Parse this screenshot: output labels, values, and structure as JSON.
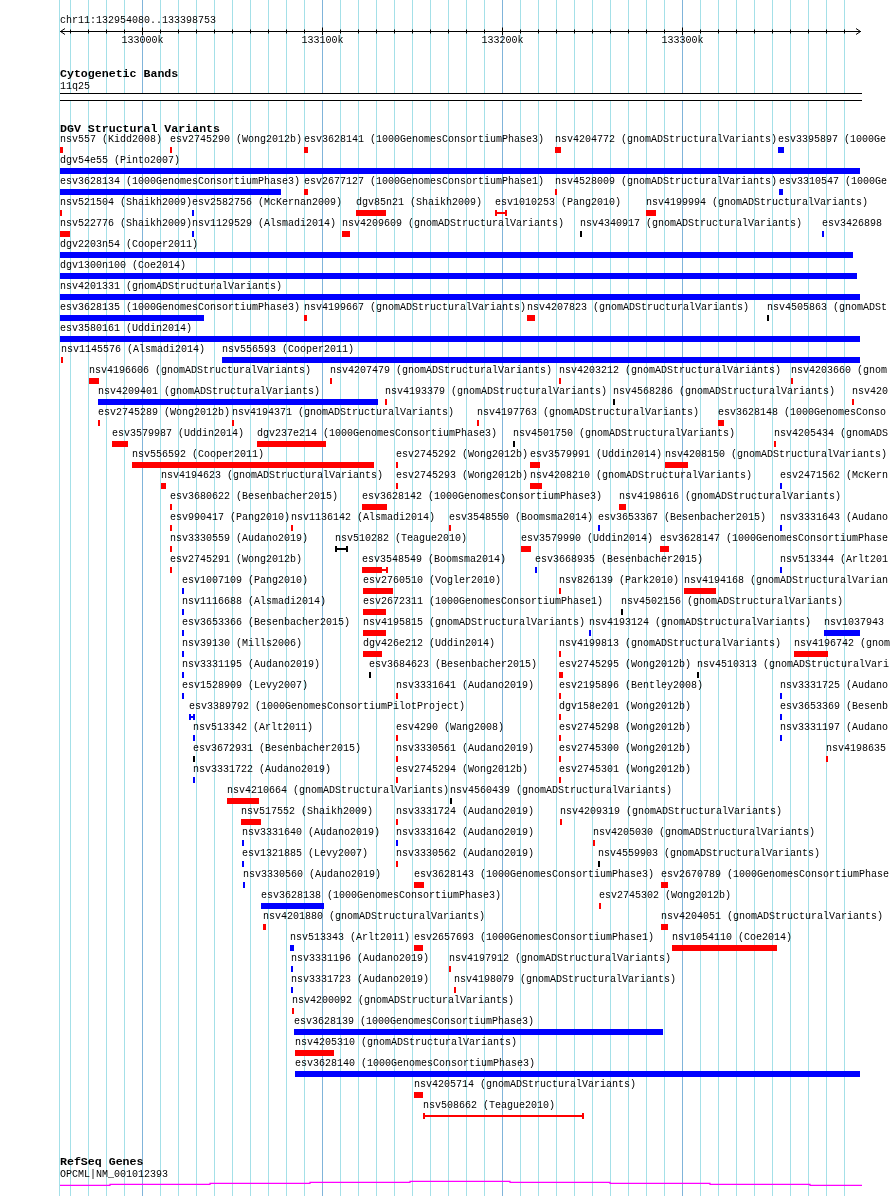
{
  "ruler": {
    "label": "chr11:132954080..133398753",
    "xticks": [
      {
        "label": "133000k"
      },
      {
        "label": "133100k"
      },
      {
        "label": "133200k"
      },
      {
        "label": "133300k"
      }
    ]
  },
  "tracks": [
    {
      "kind": "cytobands",
      "title": "Cytogenetic Bands",
      "bands": [
        {
          "label": "11q25"
        }
      ]
    },
    {
      "kind": "variants",
      "title": "DGV Structural Variants",
      "rows": [
        {
          "features": [
            {
              "label": "nsv557 (Kidd2008)",
              "kind": "bar",
              "color": "#ff0000"
            },
            {
              "label": "esv2745290 (Wong2012b)",
              "kind": "bar",
              "color": "#ff0000"
            },
            {
              "label": "esv3628141 (1000GenomesConsortiumPhase3)",
              "kind": "bar",
              "color": "#ff0000"
            },
            {
              "label": "nsv4204772 (gnomADStructuralVariants)",
              "kind": "bar",
              "color": "#ff0000"
            },
            {
              "label": "esv3395897 (1000Ge",
              "kind": "bar",
              "color": "#0000ff"
            }
          ]
        },
        {
          "features": [
            {
              "label": "dgv54e55 (Pinto2007)",
              "kind": "bar",
              "color": "#0000ff"
            }
          ]
        },
        {
          "features": [
            {
              "label": "esv3628134 (1000GenomesConsortiumPhase3)",
              "kind": "bar",
              "color": "#0000ff"
            },
            {
              "label": "esv2677127 (1000GenomesConsortiumPhase1)",
              "kind": "bar",
              "color": "#ff0000"
            },
            {
              "label": "nsv4528009 (gnomADStructuralVariants)",
              "kind": "bar",
              "color": "#ff0000"
            },
            {
              "label": "esv3310547 (1000Ge",
              "kind": "bar",
              "color": "#0000ff"
            }
          ]
        },
        {
          "features": [
            {
              "label": "nsv521504 (Shaikh2009)",
              "kind": "bar",
              "color": "#ff0000"
            },
            {
              "label": "esv2582756 (McKernan2009)",
              "kind": "bar",
              "color": "#0000ff"
            },
            {
              "label": "dgv85n21 (Shaikh2009)",
              "kind": "bar",
              "color": "#ff0000"
            },
            {
              "label": "esv1010253 (Pang2010)",
              "kind": "interval",
              "color": "#ff0000"
            },
            {
              "label": "nsv4199994 (gnomADStructuralVariants)",
              "kind": "bar",
              "color": "#ff0000"
            }
          ]
        },
        {
          "features": [
            {
              "label": "nsv522776 (Shaikh2009)",
              "kind": "bar",
              "color": "#ff0000"
            },
            {
              "label": "nsv1129529 (Alsmadi2014)",
              "kind": "bar",
              "color": "#0000ff"
            },
            {
              "label": "nsv4209609 (gnomADStructuralVariants)",
              "kind": "bar",
              "color": "#ff0000"
            },
            {
              "label": "nsv4340917 (gnomADStructuralVariants)",
              "kind": "bar",
              "color": "#000000"
            },
            {
              "label": "esv3426898",
              "kind": "bar",
              "color": "#0000ff"
            }
          ]
        },
        {
          "features": [
            {
              "label": "dgv2203n54 (Cooper2011)",
              "kind": "bar",
              "color": "#0000ff"
            }
          ]
        },
        {
          "features": [
            {
              "label": "dgv1300n100 (Coe2014)",
              "kind": "bar",
              "color": "#0000ff"
            }
          ]
        },
        {
          "features": [
            {
              "label": "nsv4201331 (gnomADStructuralVariants)",
              "kind": "bar",
              "color": "#0000ff"
            }
          ]
        },
        {
          "features": [
            {
              "label": "esv3628135 (1000GenomesConsortiumPhase3)",
              "kind": "bar",
              "color": "#0000ff"
            },
            {
              "label": "nsv4199667 (gnomADStructuralVariants)",
              "kind": "bar",
              "color": "#ff0000"
            },
            {
              "label": "nsv4207823 (gnomADStructuralVariants)",
              "kind": "bar",
              "color": "#ff0000"
            },
            {
              "label": "nsv4505863 (gnomADSt",
              "kind": "bar",
              "color": "#000000"
            }
          ]
        },
        {
          "features": [
            {
              "label": "esv3580161 (Uddin2014)",
              "kind": "bar",
              "color": "#0000ff"
            }
          ]
        },
        {
          "features": [
            {
              "label": "nsv1145576 (Alsmadi2014)",
              "kind": "bar",
              "color": "#ff0000"
            },
            {
              "label": "nsv556593 (Cooper2011)",
              "kind": "bar",
              "color": "#0000ff"
            }
          ]
        },
        {
          "features": [
            {
              "label": "nsv4196606 (gnomADStructuralVariants)",
              "kind": "bar",
              "color": "#ff0000"
            },
            {
              "label": "nsv4207479 (gnomADStructuralVariants)",
              "kind": "bar",
              "color": "#ff0000"
            },
            {
              "label": "nsv4203212 (gnomADStructuralVariants)",
              "kind": "bar",
              "color": "#ff0000"
            },
            {
              "label": "nsv4203660 (gnom",
              "kind": "bar",
              "color": "#ff0000"
            }
          ]
        },
        {
          "features": [
            {
              "label": "nsv4209401 (gnomADStructuralVariants)",
              "kind": "bar",
              "color": "#0000ff"
            },
            {
              "label": "nsv4193379 (gnomADStructuralVariants)",
              "kind": "bar",
              "color": "#ff0000"
            },
            {
              "label": "nsv4568286 (gnomADStructuralVariants)",
              "kind": "bar",
              "color": "#000000"
            },
            {
              "label": "nsv420",
              "kind": "bar",
              "color": "#ff0000"
            }
          ]
        },
        {
          "features": [
            {
              "label": "esv2745289 (Wong2012b)",
              "kind": "bar",
              "color": "#ff0000"
            },
            {
              "label": "nsv4194371 (gnomADStructuralVariants)",
              "kind": "bar",
              "color": "#ff0000"
            },
            {
              "label": "nsv4197763 (gnomADStructuralVariants)",
              "kind": "bar",
              "color": "#ff0000"
            },
            {
              "label": "esv3628148 (1000GenomesConso",
              "kind": "bar",
              "color": "#ff0000"
            }
          ]
        },
        {
          "features": [
            {
              "label": "esv3579987 (Uddin2014)",
              "kind": "bar",
              "color": "#ff0000"
            },
            {
              "label": "dgv237e214 (1000GenomesConsortiumPhase3)",
              "kind": "bar",
              "color": "#ff0000"
            },
            {
              "label": "nsv4501750 (gnomADStructuralVariants)",
              "kind": "bar",
              "color": "#000000"
            },
            {
              "label": "nsv4205434 (gnomADS",
              "kind": "bar",
              "color": "#ff0000"
            }
          ]
        },
        {
          "features": [
            {
              "label": "nsv556592 (Cooper2011)",
              "kind": "bar",
              "color": "#ff0000"
            },
            {
              "label": "esv2745292 (Wong2012b)",
              "kind": "bar",
              "color": "#ff0000"
            },
            {
              "label": "esv3579991 (Uddin2014)",
              "kind": "bar",
              "color": "#ff0000"
            },
            {
              "label": "nsv4208150 (gnomADStructuralVariants)",
              "kind": "bar",
              "color": "#ff0000"
            }
          ]
        },
        {
          "features": [
            {
              "label": "nsv4194623 (gnomADStructuralVariants)",
              "kind": "bar",
              "color": "#ff0000"
            },
            {
              "label": "esv2745293 (Wong2012b)",
              "kind": "bar",
              "color": "#ff0000"
            },
            {
              "label": "nsv4208210 (gnomADStructuralVariants)",
              "kind": "bar",
              "color": "#ff0000"
            },
            {
              "label": "esv2471562 (McKern",
              "kind": "bar",
              "color": "#0000ff"
            }
          ]
        },
        {
          "features": [
            {
              "label": "esv3680622 (Besenbacher2015)",
              "kind": "bar",
              "color": "#ff0000"
            },
            {
              "label": "esv3628142 (1000GenomesConsortiumPhase3)",
              "kind": "bar",
              "color": "#ff0000"
            },
            {
              "label": "nsv4198616 (gnomADStructuralVariants)",
              "kind": "bar",
              "color": "#ff0000"
            }
          ]
        },
        {
          "features": [
            {
              "label": "esv990417 (Pang2010)",
              "kind": "bar",
              "color": "#ff0000"
            },
            {
              "label": "nsv1136142 (Alsmadi2014)",
              "kind": "bar",
              "color": "#ff0000"
            },
            {
              "label": "esv3548550 (Boomsma2014)",
              "kind": "bar",
              "color": "#ff0000"
            },
            {
              "label": "esv3653367 (Besenbacher2015)",
              "kind": "bar",
              "color": "#0000ff"
            },
            {
              "label": "nsv3331643 (Audano",
              "kind": "bar",
              "color": "#0000ff"
            }
          ]
        },
        {
          "features": [
            {
              "label": "nsv3330559 (Audano2019)",
              "kind": "bar",
              "color": "#ff0000"
            },
            {
              "label": "nsv510282 (Teague2010)",
              "kind": "interval",
              "color": "#000000"
            },
            {
              "label": "esv3579990 (Uddin2014)",
              "kind": "bar",
              "color": "#ff0000"
            },
            {
              "label": "esv3628147 (1000GenomesConsortiumPhase",
              "kind": "bar",
              "color": "#ff0000"
            }
          ]
        },
        {
          "features": [
            {
              "label": "esv2745291 (Wong2012b)",
              "kind": "bar",
              "color": "#ff0000"
            },
            {
              "label": "esv3548549 (Boomsma2014)",
              "kind": "bar_interval",
              "color": "#ff0000"
            },
            {
              "label": "esv3668935 (Besenbacher2015)",
              "kind": "bar",
              "color": "#0000ff"
            },
            {
              "label": "nsv513344 (Arlt201",
              "kind": "bar",
              "color": "#0000ff"
            }
          ]
        },
        {
          "features": [
            {
              "label": "esv1007109 (Pang2010)",
              "kind": "bar",
              "color": "#0000ff"
            },
            {
              "label": "esv2760510 (Vogler2010)",
              "kind": "bar",
              "color": "#ff0000"
            },
            {
              "label": "nsv826139 (Park2010)",
              "kind": "bar",
              "color": "#ff0000"
            },
            {
              "label": "nsv4194168 (gnomADStructuralVarian",
              "kind": "bar",
              "color": "#ff0000"
            }
          ]
        },
        {
          "features": [
            {
              "label": "nsv1116688 (Alsmadi2014)",
              "kind": "bar",
              "color": "#0000ff"
            },
            {
              "label": "esv2672311 (1000GenomesConsortiumPhase1)",
              "kind": "bar",
              "color": "#ff0000"
            },
            {
              "label": "nsv4502156 (gnomADStructuralVariants)",
              "kind": "bar",
              "color": "#000000"
            }
          ]
        },
        {
          "features": [
            {
              "label": "esv3653366 (Besenbacher2015)",
              "kind": "bar",
              "color": "#0000ff"
            },
            {
              "label": "nsv4195815 (gnomADStructuralVariants)",
              "kind": "bar",
              "color": "#ff0000"
            },
            {
              "label": "nsv4193124 (gnomADStructuralVariants)",
              "kind": "bar",
              "color": "#0000ff"
            },
            {
              "label": "nsv1037943",
              "kind": "bar",
              "color": "#0000ff"
            }
          ]
        },
        {
          "features": [
            {
              "label": "nsv39130 (Mills2006)",
              "kind": "bar",
              "color": "#0000ff"
            },
            {
              "label": "dgv426e212 (Uddin2014)",
              "kind": "bar",
              "color": "#ff0000"
            },
            {
              "label": "nsv4199813 (gnomADStructuralVariants)",
              "kind": "bar",
              "color": "#ff0000"
            },
            {
              "label": "nsv4196742 (gnom",
              "kind": "bar",
              "color": "#ff0000"
            }
          ]
        },
        {
          "features": [
            {
              "label": "nsv3331195 (Audano2019)",
              "kind": "bar",
              "color": "#0000ff"
            },
            {
              "label": "esv3684623 (Besenbacher2015)",
              "kind": "bar",
              "color": "#000000"
            },
            {
              "label": "esv2745295 (Wong2012b)",
              "kind": "bar",
              "color": "#ff0000"
            },
            {
              "label": "nsv4510313 (gnomADStructuralVari",
              "kind": "bar",
              "color": "#000000"
            }
          ]
        },
        {
          "features": [
            {
              "label": "esv1528909 (Levy2007)",
              "kind": "bar",
              "color": "#0000ff"
            },
            {
              "label": "nsv3331641 (Audano2019)",
              "kind": "bar",
              "color": "#ff0000"
            },
            {
              "label": "esv2195896 (Bentley2008)",
              "kind": "bar",
              "color": "#ff0000"
            },
            {
              "label": "nsv3331725 (Audano",
              "kind": "bar",
              "color": "#0000ff"
            }
          ]
        },
        {
          "features": [
            {
              "label": "esv3389792 (1000GenomesConsortiumPilotProject)",
              "kind": "interval",
              "color": "#0000ff"
            },
            {
              "label": "dgv158e201 (Wong2012b)",
              "kind": "bar",
              "color": "#ff0000"
            },
            {
              "label": "esv3653369 (Besenb",
              "kind": "bar",
              "color": "#0000ff"
            }
          ]
        },
        {
          "features": [
            {
              "label": "nsv513342 (Arlt2011)",
              "kind": "bar",
              "color": "#0000ff"
            },
            {
              "label": "esv4290 (Wang2008)",
              "kind": "bar",
              "color": "#ff0000"
            },
            {
              "label": "esv2745298 (Wong2012b)",
              "kind": "bar",
              "color": "#ff0000"
            },
            {
              "label": "nsv3331197 (Audano",
              "kind": "bar",
              "color": "#0000ff"
            }
          ]
        },
        {
          "features": [
            {
              "label": "esv3672931 (Besenbacher2015)",
              "kind": "bar",
              "color": "#000000"
            },
            {
              "label": "nsv3330561 (Audano2019)",
              "kind": "bar",
              "color": "#ff0000"
            },
            {
              "label": "esv2745300 (Wong2012b)",
              "kind": "bar",
              "color": "#ff0000"
            },
            {
              "label": "nsv4198635",
              "kind": "bar",
              "color": "#ff0000"
            }
          ]
        },
        {
          "features": [
            {
              "label": "nsv3331722 (Audano2019)",
              "kind": "bar",
              "color": "#0000ff"
            },
            {
              "label": "esv2745294 (Wong2012b)",
              "kind": "bar",
              "color": "#ff0000"
            },
            {
              "label": "esv2745301 (Wong2012b)",
              "kind": "bar",
              "color": "#ff0000"
            }
          ]
        },
        {
          "features": [
            {
              "label": "nsv4210664 (gnomADStructuralVariants)",
              "kind": "bar",
              "color": "#ff0000"
            },
            {
              "label": "nsv4560439 (gnomADStructuralVariants)",
              "kind": "bar",
              "color": "#000000"
            }
          ]
        },
        {
          "features": [
            {
              "label": "nsv517552 (Shaikh2009)",
              "kind": "bar",
              "color": "#ff0000"
            },
            {
              "label": "nsv3331724 (Audano2019)",
              "kind": "bar",
              "color": "#ff0000"
            },
            {
              "label": "nsv4209319 (gnomADStructuralVariants)",
              "kind": "bar",
              "color": "#ff0000"
            }
          ]
        },
        {
          "features": [
            {
              "label": "nsv3331640 (Audano2019)",
              "kind": "bar",
              "color": "#0000ff"
            },
            {
              "label": "nsv3331642 (Audano2019)",
              "kind": "bar",
              "color": "#0000ff"
            },
            {
              "label": "nsv4205030 (gnomADStructuralVariants)",
              "kind": "bar",
              "color": "#ff0000"
            }
          ]
        },
        {
          "features": [
            {
              "label": "esv1321885 (Levy2007)",
              "kind": "bar",
              "color": "#0000ff"
            },
            {
              "label": "nsv3330562 (Audano2019)",
              "kind": "bar",
              "color": "#ff0000"
            },
            {
              "label": "nsv4559903 (gnomADStructuralVariants)",
              "kind": "bar",
              "color": "#000000"
            }
          ]
        },
        {
          "features": [
            {
              "label": "nsv3330560 (Audano2019)",
              "kind": "bar",
              "color": "#0000ff"
            },
            {
              "label": "esv3628143 (1000GenomesConsortiumPhase3)",
              "kind": "bar",
              "color": "#ff0000"
            },
            {
              "label": "esv2670789 (1000GenomesConsortiumPhase",
              "kind": "bar",
              "color": "#ff0000"
            }
          ]
        },
        {
          "features": [
            {
              "label": "esv3628138 (1000GenomesConsortiumPhase3)",
              "kind": "bar",
              "color": "#0000ff"
            },
            {
              "label": "esv2745302 (Wong2012b)",
              "kind": "bar",
              "color": "#ff0000"
            }
          ]
        },
        {
          "features": [
            {
              "label": "nsv4201880 (gnomADStructuralVariants)",
              "kind": "bar",
              "color": "#ff0000"
            },
            {
              "label": "nsv4204051 (gnomADStructuralVariants)",
              "kind": "bar",
              "color": "#ff0000"
            }
          ]
        },
        {
          "features": [
            {
              "label": "nsv513343 (Arlt2011)",
              "kind": "bar",
              "color": "#0000ff"
            },
            {
              "label": "esv2657693 (1000GenomesConsortiumPhase1)",
              "kind": "bar",
              "color": "#ff0000"
            },
            {
              "label": "nsv1054110 (Coe2014)",
              "kind": "bar",
              "color": "#ff0000"
            }
          ]
        },
        {
          "features": [
            {
              "label": "nsv3331196 (Audano2019)",
              "kind": "bar",
              "color": "#0000ff"
            },
            {
              "label": "nsv4197912 (gnomADStructuralVariants)",
              "kind": "bar",
              "color": "#ff0000"
            }
          ]
        },
        {
          "features": [
            {
              "label": "nsv3331723 (Audano2019)",
              "kind": "bar",
              "color": "#0000ff"
            },
            {
              "label": "nsv4198079 (gnomADStructuralVariants)",
              "kind": "bar",
              "color": "#ff0000"
            }
          ]
        },
        {
          "features": [
            {
              "label": "nsv4200092 (gnomADStructuralVariants)",
              "kind": "bar",
              "color": "#ff0000"
            }
          ]
        },
        {
          "features": [
            {
              "label": "esv3628139 (1000GenomesConsortiumPhase3)",
              "kind": "bar",
              "color": "#0000ff"
            }
          ]
        },
        {
          "features": [
            {
              "label": "nsv4205310 (gnomADStructuralVariants)",
              "kind": "bar",
              "color": "#ff0000"
            }
          ]
        },
        {
          "features": [
            {
              "label": "esv3628140 (1000GenomesConsortiumPhase3)",
              "kind": "bar",
              "color": "#0000ff"
            }
          ]
        },
        {
          "features": [
            {
              "label": "nsv4205714 (gnomADStructuralVariants)",
              "kind": "bar",
              "color": "#ff0000"
            }
          ]
        },
        {
          "features": [
            {
              "label": "nsv508662 (Teague2010)",
              "kind": "interval",
              "color": "#ff0000"
            }
          ]
        }
      ]
    },
    {
      "kind": "genes",
      "title": "RefSeq Genes",
      "genes": [
        {
          "label": "OPCML|NM_001012393"
        }
      ]
    }
  ]
}
